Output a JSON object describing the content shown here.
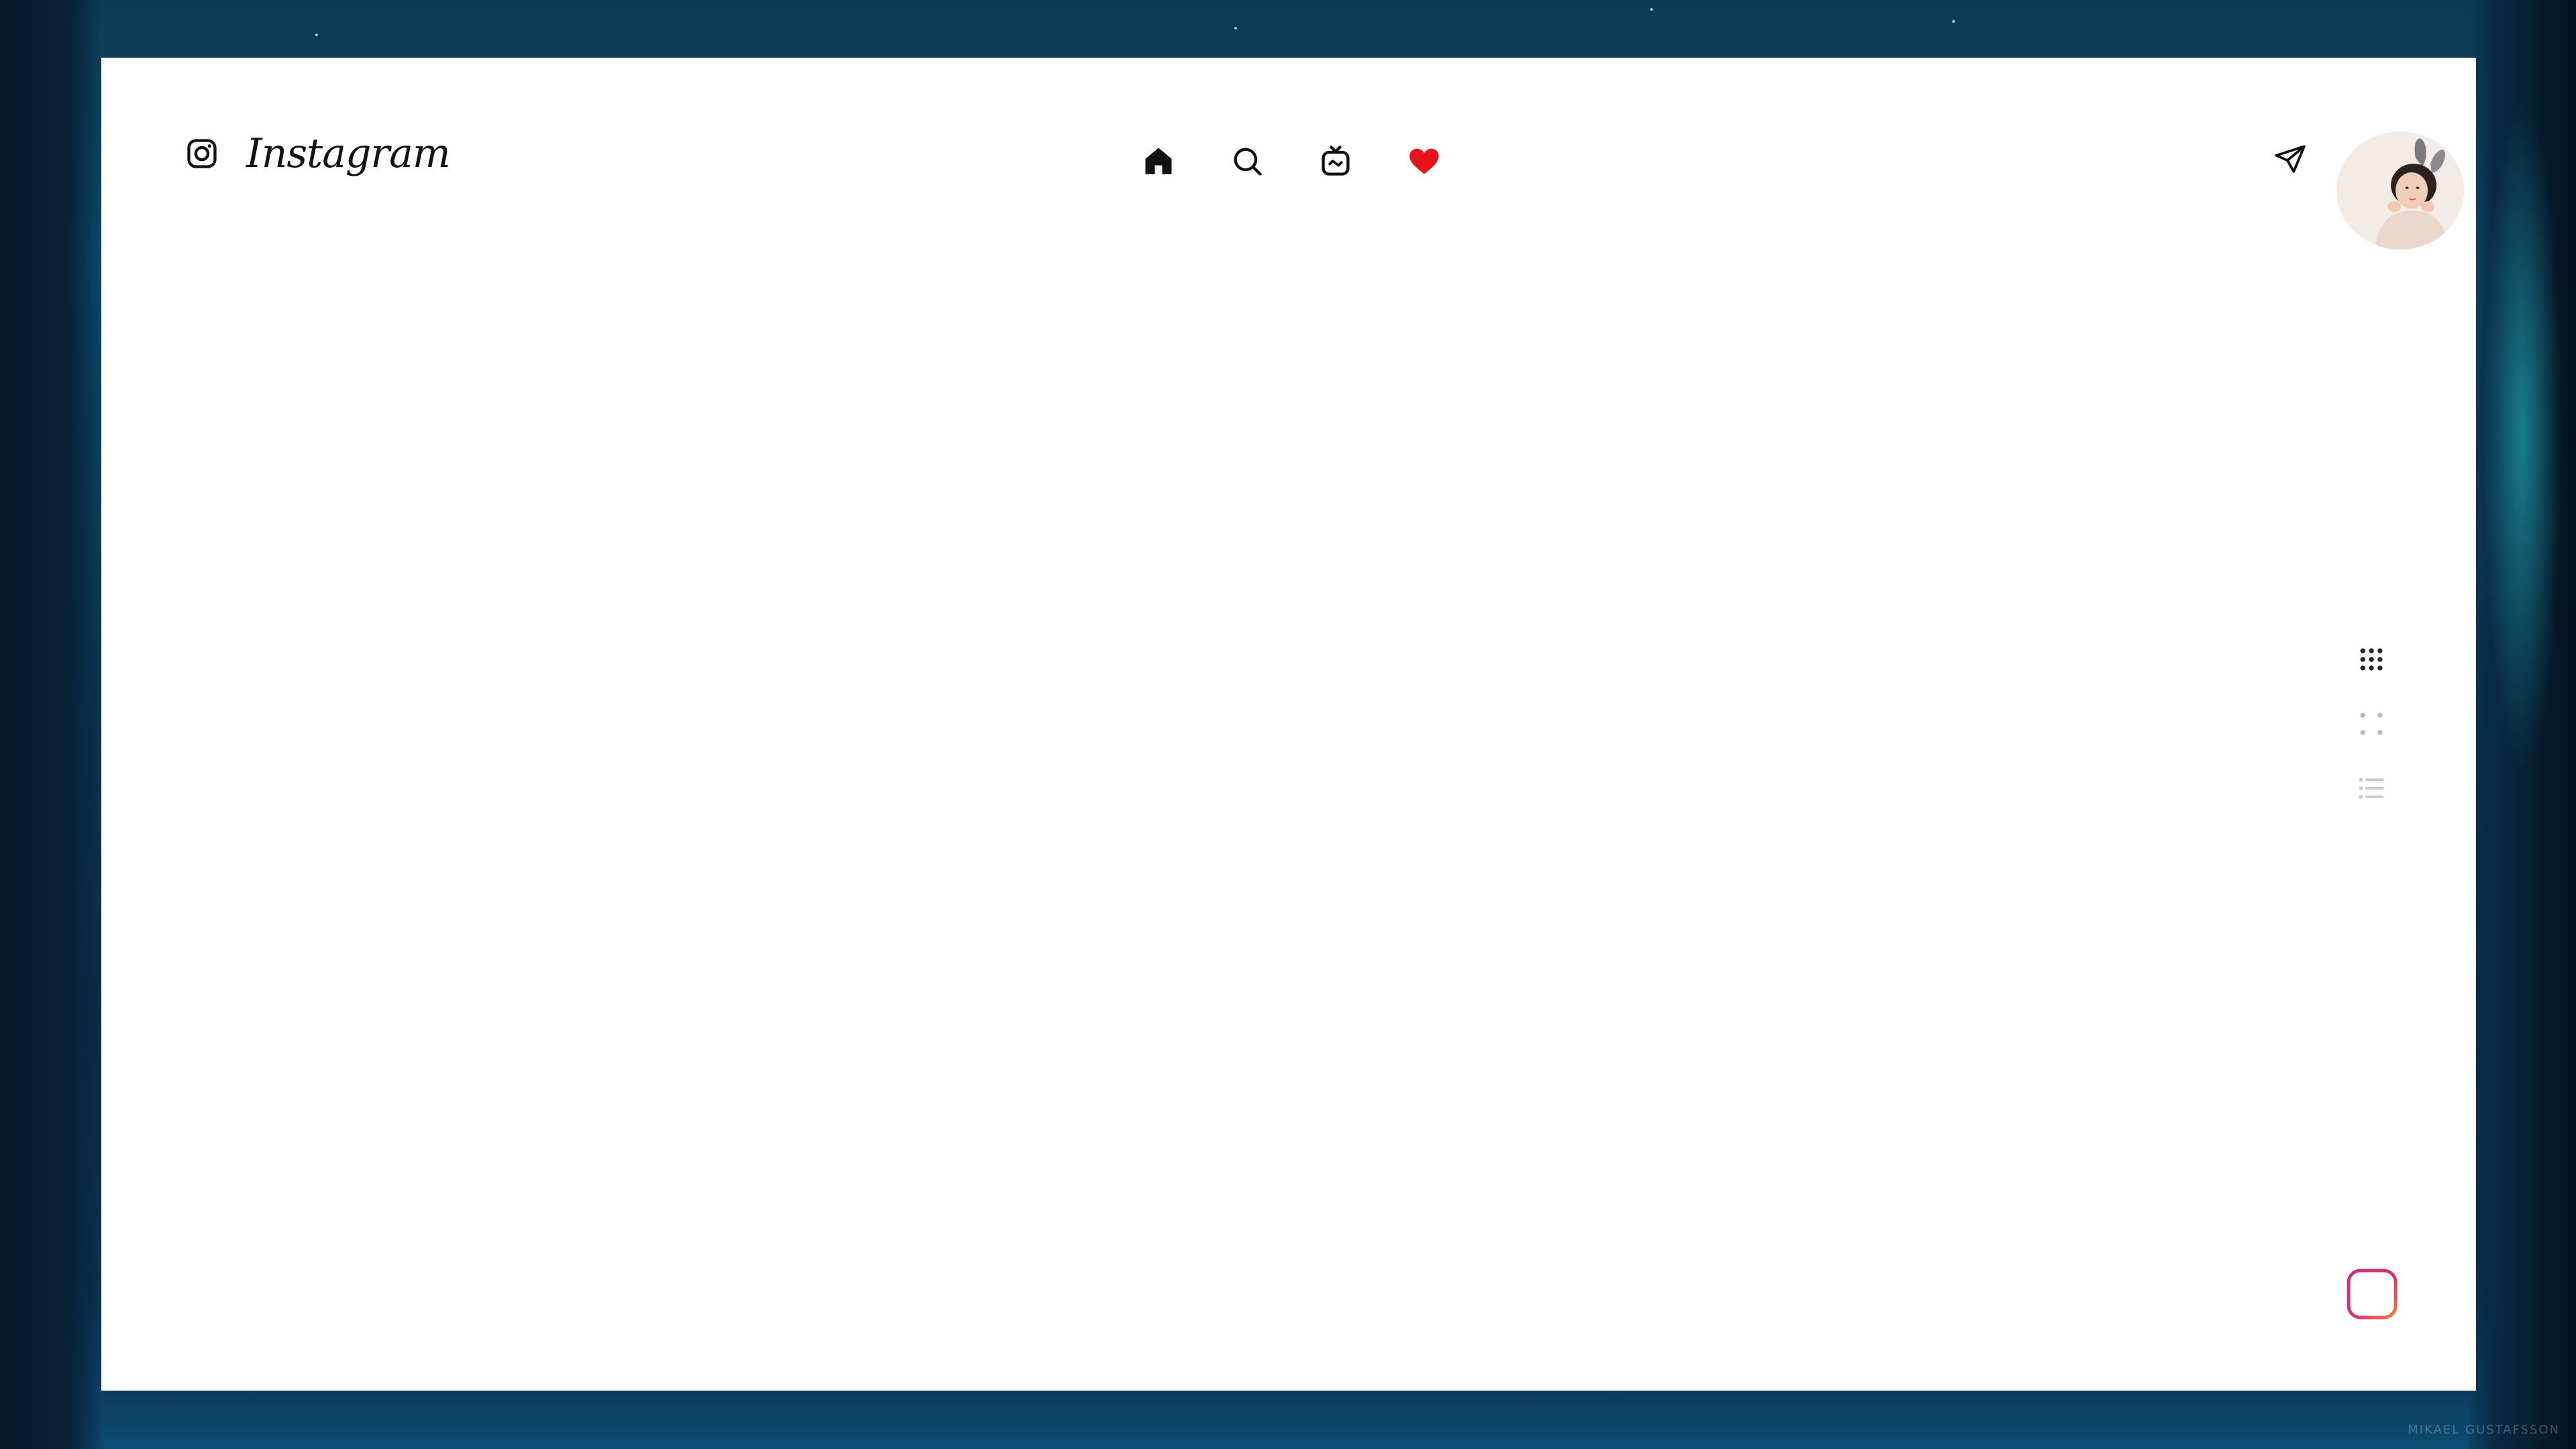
{
  "app": {
    "name": "Instagram",
    "brand_color": "#111111",
    "heart_color": "#e8141c"
  },
  "header": {
    "logo_icon": "instagram-camera-icon",
    "brand_text": "Instagram",
    "nav": [
      {
        "name": "home",
        "icon": "home-icon",
        "active": true
      },
      {
        "name": "search",
        "icon": "search-icon"
      },
      {
        "name": "igtv",
        "icon": "igtv-icon"
      },
      {
        "name": "activity",
        "icon": "heart-icon",
        "filled": true
      }
    ],
    "direct_icon": "paper-plane-icon"
  },
  "view_modes": [
    {
      "name": "grid-3",
      "icon": "grid-nine-dots-icon",
      "active": true
    },
    {
      "name": "grid-2",
      "icon": "grid-four-dots-icon",
      "active": false
    },
    {
      "name": "list",
      "icon": "list-icon",
      "active": false
    }
  ],
  "fab": {
    "icon": "plus-square-icon"
  },
  "wallpaper": {
    "credit": "MIKAEL GUSTAFSSON"
  }
}
